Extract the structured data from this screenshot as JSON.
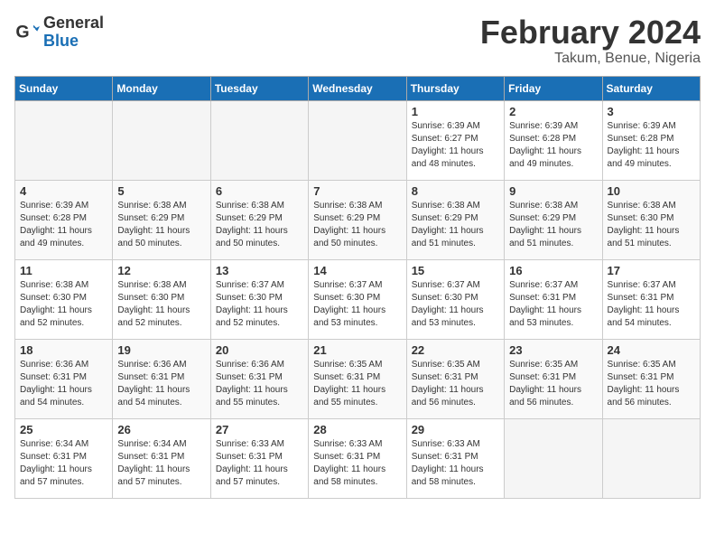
{
  "logo": {
    "text_general": "General",
    "text_blue": "Blue"
  },
  "title": "February 2024",
  "subtitle": "Takum, Benue, Nigeria",
  "weekdays": [
    "Sunday",
    "Monday",
    "Tuesday",
    "Wednesday",
    "Thursday",
    "Friday",
    "Saturday"
  ],
  "weeks": [
    [
      {
        "day": null
      },
      {
        "day": null
      },
      {
        "day": null
      },
      {
        "day": null
      },
      {
        "day": 1,
        "sunrise": "6:39 AM",
        "sunset": "6:27 PM",
        "daylight": "11 hours and 48 minutes."
      },
      {
        "day": 2,
        "sunrise": "6:39 AM",
        "sunset": "6:28 PM",
        "daylight": "11 hours and 49 minutes."
      },
      {
        "day": 3,
        "sunrise": "6:39 AM",
        "sunset": "6:28 PM",
        "daylight": "11 hours and 49 minutes."
      }
    ],
    [
      {
        "day": 4,
        "sunrise": "6:39 AM",
        "sunset": "6:28 PM",
        "daylight": "11 hours and 49 minutes."
      },
      {
        "day": 5,
        "sunrise": "6:38 AM",
        "sunset": "6:29 PM",
        "daylight": "11 hours and 50 minutes."
      },
      {
        "day": 6,
        "sunrise": "6:38 AM",
        "sunset": "6:29 PM",
        "daylight": "11 hours and 50 minutes."
      },
      {
        "day": 7,
        "sunrise": "6:38 AM",
        "sunset": "6:29 PM",
        "daylight": "11 hours and 50 minutes."
      },
      {
        "day": 8,
        "sunrise": "6:38 AM",
        "sunset": "6:29 PM",
        "daylight": "11 hours and 51 minutes."
      },
      {
        "day": 9,
        "sunrise": "6:38 AM",
        "sunset": "6:29 PM",
        "daylight": "11 hours and 51 minutes."
      },
      {
        "day": 10,
        "sunrise": "6:38 AM",
        "sunset": "6:30 PM",
        "daylight": "11 hours and 51 minutes."
      }
    ],
    [
      {
        "day": 11,
        "sunrise": "6:38 AM",
        "sunset": "6:30 PM",
        "daylight": "11 hours and 52 minutes."
      },
      {
        "day": 12,
        "sunrise": "6:38 AM",
        "sunset": "6:30 PM",
        "daylight": "11 hours and 52 minutes."
      },
      {
        "day": 13,
        "sunrise": "6:37 AM",
        "sunset": "6:30 PM",
        "daylight": "11 hours and 52 minutes."
      },
      {
        "day": 14,
        "sunrise": "6:37 AM",
        "sunset": "6:30 PM",
        "daylight": "11 hours and 53 minutes."
      },
      {
        "day": 15,
        "sunrise": "6:37 AM",
        "sunset": "6:30 PM",
        "daylight": "11 hours and 53 minutes."
      },
      {
        "day": 16,
        "sunrise": "6:37 AM",
        "sunset": "6:31 PM",
        "daylight": "11 hours and 53 minutes."
      },
      {
        "day": 17,
        "sunrise": "6:37 AM",
        "sunset": "6:31 PM",
        "daylight": "11 hours and 54 minutes."
      }
    ],
    [
      {
        "day": 18,
        "sunrise": "6:36 AM",
        "sunset": "6:31 PM",
        "daylight": "11 hours and 54 minutes."
      },
      {
        "day": 19,
        "sunrise": "6:36 AM",
        "sunset": "6:31 PM",
        "daylight": "11 hours and 54 minutes."
      },
      {
        "day": 20,
        "sunrise": "6:36 AM",
        "sunset": "6:31 PM",
        "daylight": "11 hours and 55 minutes."
      },
      {
        "day": 21,
        "sunrise": "6:35 AM",
        "sunset": "6:31 PM",
        "daylight": "11 hours and 55 minutes."
      },
      {
        "day": 22,
        "sunrise": "6:35 AM",
        "sunset": "6:31 PM",
        "daylight": "11 hours and 56 minutes."
      },
      {
        "day": 23,
        "sunrise": "6:35 AM",
        "sunset": "6:31 PM",
        "daylight": "11 hours and 56 minutes."
      },
      {
        "day": 24,
        "sunrise": "6:35 AM",
        "sunset": "6:31 PM",
        "daylight": "11 hours and 56 minutes."
      }
    ],
    [
      {
        "day": 25,
        "sunrise": "6:34 AM",
        "sunset": "6:31 PM",
        "daylight": "11 hours and 57 minutes."
      },
      {
        "day": 26,
        "sunrise": "6:34 AM",
        "sunset": "6:31 PM",
        "daylight": "11 hours and 57 minutes."
      },
      {
        "day": 27,
        "sunrise": "6:33 AM",
        "sunset": "6:31 PM",
        "daylight": "11 hours and 57 minutes."
      },
      {
        "day": 28,
        "sunrise": "6:33 AM",
        "sunset": "6:31 PM",
        "daylight": "11 hours and 58 minutes."
      },
      {
        "day": 29,
        "sunrise": "6:33 AM",
        "sunset": "6:31 PM",
        "daylight": "11 hours and 58 minutes."
      },
      {
        "day": null
      },
      {
        "day": null
      }
    ]
  ],
  "labels": {
    "sunrise": "Sunrise:",
    "sunset": "Sunset:",
    "daylight": "Daylight:"
  }
}
